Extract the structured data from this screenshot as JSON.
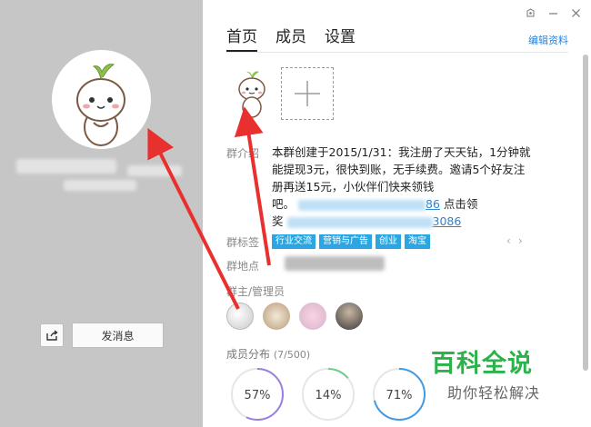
{
  "left": {
    "send_message_label": "发消息"
  },
  "tabs": [
    {
      "label": "首页",
      "active": true
    },
    {
      "label": "成员",
      "active": false
    },
    {
      "label": "设置",
      "active": false
    }
  ],
  "edit_profile": "编辑资料",
  "intro": {
    "label": "群介绍",
    "text_line1": "本群创建于2015/1/31：我注册了天天钻，1分钟就",
    "text_line2": "能提现3元，很快到账，无手续费。邀请5个好友注",
    "text_line3": "册再送15元，小伙伴们快来领钱",
    "text_line4_prefix": "吧。",
    "link1_suffix": "86",
    "line4_action": "点击领",
    "line5_prefix": "奖",
    "link2_suffix": "3086"
  },
  "tags_label": "群标签",
  "tags": [
    "行业交流",
    "营销与广告",
    "创业",
    "淘宝"
  ],
  "location_label": "群地点",
  "admins_label": "群主/管理员",
  "member_dist": {
    "label": "成员分布",
    "count": "(7/500)"
  },
  "distribution": [
    {
      "value": "57%",
      "percent": 57,
      "color": "#9b7fe0"
    },
    {
      "value": "14%",
      "percent": 14,
      "color": "#6ccf8e"
    },
    {
      "value": "71%",
      "percent": 71,
      "color": "#3f9be6"
    }
  ],
  "watermark": {
    "title": "百科全说",
    "subtitle": "助你轻松解决"
  }
}
